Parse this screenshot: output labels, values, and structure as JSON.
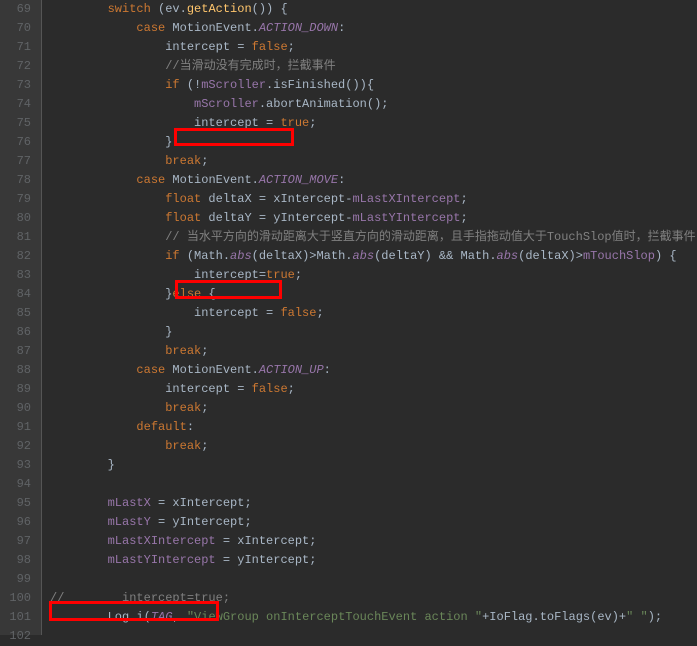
{
  "gutter": {
    "lines": [
      69,
      70,
      71,
      72,
      73,
      74,
      75,
      76,
      77,
      78,
      79,
      80,
      81,
      82,
      83,
      84,
      85,
      86,
      87,
      88,
      89,
      90,
      91,
      92,
      93,
      94,
      95,
      96,
      97,
      98,
      99,
      100,
      101,
      102
    ]
  },
  "code": {
    "l69": {
      "pre": "        ",
      "t": [
        [
          "kw",
          "switch"
        ],
        [
          "punct",
          " (ev."
        ],
        [
          "method",
          "getAction"
        ],
        [
          "punct",
          "()) {"
        ]
      ]
    },
    "l70": {
      "pre": "            ",
      "t": [
        [
          "kw",
          "case"
        ],
        [
          "punct",
          " MotionEvent."
        ],
        [
          "static",
          "ACTION_DOWN"
        ],
        [
          "punct",
          ":"
        ]
      ]
    },
    "l71": {
      "pre": "                ",
      "t": [
        [
          "punct",
          "intercept = "
        ],
        [
          "kw",
          "false"
        ],
        [
          "punct",
          ";"
        ]
      ]
    },
    "l72": {
      "pre": "                ",
      "t": [
        [
          "cmt",
          "//当滑动没有完成时，拦截事件"
        ]
      ]
    },
    "l73": {
      "pre": "                ",
      "t": [
        [
          "kw",
          "if"
        ],
        [
          "punct",
          " (!"
        ],
        [
          "ident",
          "mScroller"
        ],
        [
          "punct",
          ".isFinished()){"
        ]
      ]
    },
    "l74": {
      "pre": "                    ",
      "t": [
        [
          "ident",
          "mScroller"
        ],
        [
          "punct",
          ".abortAnimation();"
        ]
      ]
    },
    "l75": {
      "pre": "                    ",
      "t": [
        [
          "punct",
          "intercept = "
        ],
        [
          "kw",
          "true"
        ],
        [
          "punct",
          ";"
        ]
      ]
    },
    "l76": {
      "pre": "                ",
      "t": [
        [
          "punct",
          "}"
        ]
      ]
    },
    "l77": {
      "pre": "                ",
      "t": [
        [
          "kw",
          "break"
        ],
        [
          "punct",
          ";"
        ]
      ]
    },
    "l78": {
      "pre": "            ",
      "t": [
        [
          "kw",
          "case"
        ],
        [
          "punct",
          " MotionEvent."
        ],
        [
          "static",
          "ACTION_MOVE"
        ],
        [
          "punct",
          ":"
        ]
      ]
    },
    "l79": {
      "pre": "                ",
      "t": [
        [
          "type",
          "float"
        ],
        [
          "punct",
          " deltaX = xIntercept-"
        ],
        [
          "ident",
          "mLastXIntercept"
        ],
        [
          "punct",
          ";"
        ]
      ]
    },
    "l80": {
      "pre": "                ",
      "t": [
        [
          "type",
          "float"
        ],
        [
          "punct",
          " deltaY = yIntercept-"
        ],
        [
          "ident",
          "mLastYIntercept"
        ],
        [
          "punct",
          ";"
        ]
      ]
    },
    "l81": {
      "pre": "                ",
      "t": [
        [
          "cmt",
          "// 当水平方向的滑动距离大于竖直方向的滑动距离，且手指拖动值大于TouchSlop值时，拦截事件"
        ]
      ]
    },
    "l82": {
      "pre": "                ",
      "t": [
        [
          "kw",
          "if"
        ],
        [
          "punct",
          " (Math."
        ],
        [
          "static",
          "abs"
        ],
        [
          "punct",
          "(deltaX)>Math."
        ],
        [
          "static",
          "abs"
        ],
        [
          "punct",
          "(deltaY) && Math."
        ],
        [
          "static",
          "abs"
        ],
        [
          "punct",
          "(deltaX)>"
        ],
        [
          "ident",
          "mTouchSlop"
        ],
        [
          "punct",
          ") {"
        ]
      ]
    },
    "l83": {
      "pre": "                    ",
      "t": [
        [
          "punct",
          "intercept="
        ],
        [
          "kw",
          "true"
        ],
        [
          "punct",
          ";"
        ]
      ]
    },
    "l84": {
      "pre": "                ",
      "t": [
        [
          "punct",
          "}"
        ],
        [
          "kw",
          "else"
        ],
        [
          "punct",
          " {"
        ]
      ]
    },
    "l85": {
      "pre": "                    ",
      "t": [
        [
          "punct",
          "intercept = "
        ],
        [
          "kw",
          "false"
        ],
        [
          "punct",
          ";"
        ]
      ]
    },
    "l86": {
      "pre": "                ",
      "t": [
        [
          "punct",
          "}"
        ]
      ]
    },
    "l87": {
      "pre": "                ",
      "t": [
        [
          "kw",
          "break"
        ],
        [
          "punct",
          ";"
        ]
      ]
    },
    "l88": {
      "pre": "            ",
      "t": [
        [
          "kw",
          "case"
        ],
        [
          "punct",
          " MotionEvent."
        ],
        [
          "static",
          "ACTION_UP"
        ],
        [
          "punct",
          ":"
        ]
      ]
    },
    "l89": {
      "pre": "                ",
      "t": [
        [
          "punct",
          "intercept = "
        ],
        [
          "kw",
          "false"
        ],
        [
          "punct",
          ";"
        ]
      ]
    },
    "l90": {
      "pre": "                ",
      "t": [
        [
          "kw",
          "break"
        ],
        [
          "punct",
          ";"
        ]
      ]
    },
    "l91": {
      "pre": "            ",
      "t": [
        [
          "kw",
          "default"
        ],
        [
          "punct",
          ":"
        ]
      ]
    },
    "l92": {
      "pre": "                ",
      "t": [
        [
          "kw",
          "break"
        ],
        [
          "punct",
          ";"
        ]
      ]
    },
    "l93": {
      "pre": "        ",
      "t": [
        [
          "punct",
          "}"
        ]
      ]
    },
    "l94": {
      "pre": "",
      "t": [
        [
          "",
          ""
        ]
      ]
    },
    "l95": {
      "pre": "        ",
      "t": [
        [
          "ident",
          "mLastX"
        ],
        [
          "punct",
          " = xIntercept;"
        ]
      ]
    },
    "l96": {
      "pre": "        ",
      "t": [
        [
          "ident",
          "mLastY"
        ],
        [
          "punct",
          " = yIntercept;"
        ]
      ]
    },
    "l97": {
      "pre": "        ",
      "t": [
        [
          "ident",
          "mLastXIntercept"
        ],
        [
          "punct",
          " = xIntercept;"
        ]
      ]
    },
    "l98": {
      "pre": "        ",
      "t": [
        [
          "ident",
          "mLastYIntercept"
        ],
        [
          "punct",
          " = yIntercept;"
        ]
      ]
    },
    "l99": {
      "pre": "",
      "t": [
        [
          "",
          ""
        ]
      ]
    },
    "l100": {
      "pre": "",
      "t": [
        [
          "cmt",
          "//        intercept=true;"
        ]
      ]
    },
    "l101": {
      "pre": "        ",
      "t": [
        [
          "punct",
          "Log.i("
        ],
        [
          "static",
          "TAG"
        ],
        [
          "punct",
          ", "
        ],
        [
          "str",
          "\"ViewGroup onInterceptTouchEvent action \""
        ],
        [
          "punct",
          "+IoFlag.toFlags(ev)+"
        ],
        [
          "str",
          "\" \""
        ],
        [
          "punct",
          ");"
        ]
      ]
    }
  }
}
